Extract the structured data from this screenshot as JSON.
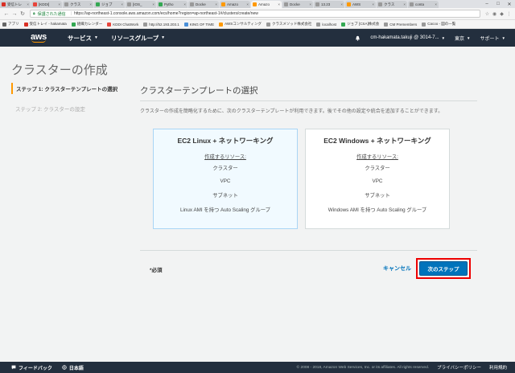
{
  "browser": {
    "tabs": [
      {
        "label": "受信トレ",
        "color": "#d93025"
      },
      {
        "label": "[KDDI]",
        "color": "#e8453c"
      },
      {
        "label": "クラス",
        "color": "#999999"
      },
      {
        "label": "ジョブ",
        "color": "#34a853"
      },
      {
        "label": "[IOS_",
        "color": "#999999"
      },
      {
        "label": "Pytho",
        "color": "#34a853"
      },
      {
        "label": "Docke",
        "color": "#999999"
      },
      {
        "label": "Amazo",
        "color": "#ff9900"
      },
      {
        "label": "Amazo",
        "color": "#ff9900"
      },
      {
        "label": "Docke",
        "color": "#999999"
      },
      {
        "label": "13.23",
        "color": "#999999"
      },
      {
        "label": "AWS",
        "color": "#ff9900"
      },
      {
        "label": "クラス",
        "color": "#999999"
      },
      {
        "label": "conta",
        "color": "#999999"
      }
    ],
    "active_tab_index": 8,
    "secure_label": "保護された通信",
    "url": "https://ap-northeast-1.console.aws.amazon.com/ecs/home?region=ap-northeast-1#/clusters/create/new",
    "bookmarks": [
      {
        "label": "アプリ",
        "color": "#666666"
      },
      {
        "label": "受信トレイ - hakamata",
        "color": "#d93025"
      },
      {
        "label": "組織カレンダー",
        "color": "#34a853"
      },
      {
        "label": "KDDI ChatWork",
        "color": "#e8453c"
      },
      {
        "label": "http://52.193.203.1",
        "color": "#999999"
      },
      {
        "label": "KING OF TIME",
        "color": "#4a90d9"
      },
      {
        "label": "AWSコンサルティング",
        "color": "#ff9900"
      },
      {
        "label": "クラスメソッド株式会社",
        "color": "#999999"
      },
      {
        "label": "localhost",
        "color": "#999999"
      },
      {
        "label": "ジョブ [CSA]株式会",
        "color": "#34a853"
      },
      {
        "label": "CM Premembers",
        "color": "#999999"
      },
      {
        "label": "Cacoo - 図の一覧",
        "color": "#999999"
      }
    ]
  },
  "awsnav": {
    "logo": "aws",
    "services": "サービス",
    "resource_groups": "リソースグループ",
    "account": "cm-hakamata.takuji @ 3014-7...",
    "region": "東京",
    "support": "サポート"
  },
  "page": {
    "title": "クラスターの作成",
    "steps": [
      {
        "label": "ステップ 1: クラスターテンプレートの選択"
      },
      {
        "label": "ステップ 2: クラスターの設定"
      }
    ],
    "section_title": "クラスターテンプレートの選択",
    "description": "クラスターの作成を簡略化するために、次のクラスターテンプレートが利用できます。後でその他の設定や統合を追加することができます。",
    "templates": [
      {
        "title": "EC2 Linux + ネットワーキング",
        "resources_label": "作成するリソース:",
        "items": [
          "クラスター",
          "VPC",
          "サブネット",
          "Linux AMI を持つ Auto Scaling グループ"
        ]
      },
      {
        "title": "EC2 Windows + ネットワーキング",
        "resources_label": "作成するリソース:",
        "items": [
          "クラスター",
          "VPC",
          "サブネット",
          "Windows AMI を持つ Auto Scaling グループ"
        ]
      }
    ],
    "required": "*必須",
    "cancel": "キャンセル",
    "next": "次のステップ"
  },
  "footer": {
    "feedback": "フィードバック",
    "language": "日本語",
    "copyright": "© 2008 - 2018, Amazon Web Services, Inc. or its affiliates. All rights reserved.",
    "privacy": "プライバシーポリシー",
    "terms": "利用規約"
  },
  "colors": {
    "aws_nav": "#232f3e",
    "accent_orange": "#ff9900",
    "primary_blue": "#0073bb",
    "highlight_red": "#ee0000"
  }
}
